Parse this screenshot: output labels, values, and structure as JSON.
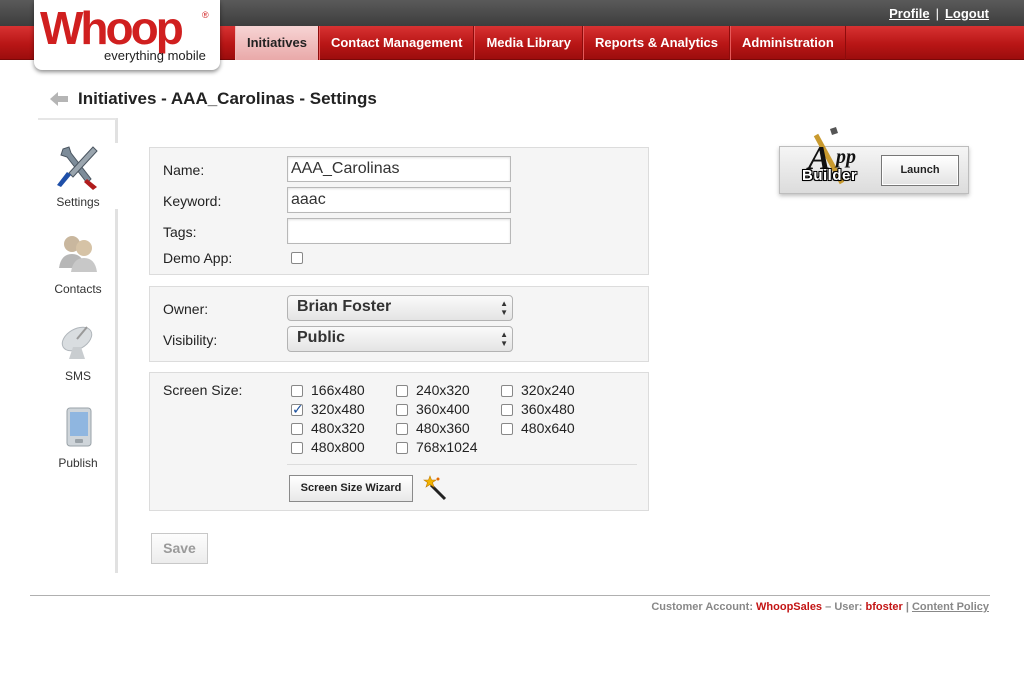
{
  "header": {
    "logo_word": "Whoop",
    "logo_reg": "®",
    "logo_tagline": "everything mobile",
    "profile_link": "Profile",
    "separator": "|",
    "logout_link": "Logout",
    "tabs": [
      {
        "label": "Initiatives",
        "active": true
      },
      {
        "label": "Contact Management",
        "active": false
      },
      {
        "label": "Media Library",
        "active": false
      },
      {
        "label": "Reports & Analytics",
        "active": false
      },
      {
        "label": "Administration",
        "active": false
      }
    ]
  },
  "page": {
    "title": "Initiatives - AAA_Carolinas - Settings"
  },
  "sidenav": {
    "items": [
      {
        "label": "Settings",
        "icon": "tools-icon",
        "active": true
      },
      {
        "label": "Contacts",
        "icon": "contacts-icon",
        "active": false
      },
      {
        "label": "SMS",
        "icon": "satellite-dish-icon",
        "active": false
      },
      {
        "label": "Publish",
        "icon": "mobile-device-icon",
        "active": false
      }
    ]
  },
  "general": {
    "name_label": "Name:",
    "name_value": "AAA_Carolinas",
    "keyword_label": "Keyword:",
    "keyword_value": "aaac",
    "tags_label": "Tags:",
    "tags_value": "",
    "demo_label": "Demo App:",
    "demo_checked": false
  },
  "access": {
    "owner_label": "Owner:",
    "owner_value": "Brian Foster",
    "visibility_label": "Visibility:",
    "visibility_value": "Public"
  },
  "screen": {
    "label": "Screen Size:",
    "sizes": [
      {
        "label": "166x480",
        "checked": false
      },
      {
        "label": "240x320",
        "checked": false
      },
      {
        "label": "320x240",
        "checked": false
      },
      {
        "label": "320x480",
        "checked": true
      },
      {
        "label": "360x400",
        "checked": false
      },
      {
        "label": "360x480",
        "checked": false
      },
      {
        "label": "480x320",
        "checked": false
      },
      {
        "label": "480x360",
        "checked": false
      },
      {
        "label": "480x640",
        "checked": false
      },
      {
        "label": "480x800",
        "checked": false
      },
      {
        "label": "768x1024",
        "checked": false
      }
    ],
    "wizard_label": "Screen Size Wizard"
  },
  "actions": {
    "save_label": "Save"
  },
  "app_builder": {
    "logo_letter": "A",
    "logo_rest": "pp",
    "logo_word": "Builder",
    "launch_label": "Launch"
  },
  "footer": {
    "account_label": "Customer Account:",
    "account_value": "WhoopSales",
    "dash": "–",
    "user_label": "User:",
    "user_value": "bfoster",
    "separator": "|",
    "policy_link": "Content Policy"
  },
  "colors": {
    "brand_red": "#d01f1f",
    "nav_red": "#b81616",
    "active_tab": "#f1c4c4"
  }
}
